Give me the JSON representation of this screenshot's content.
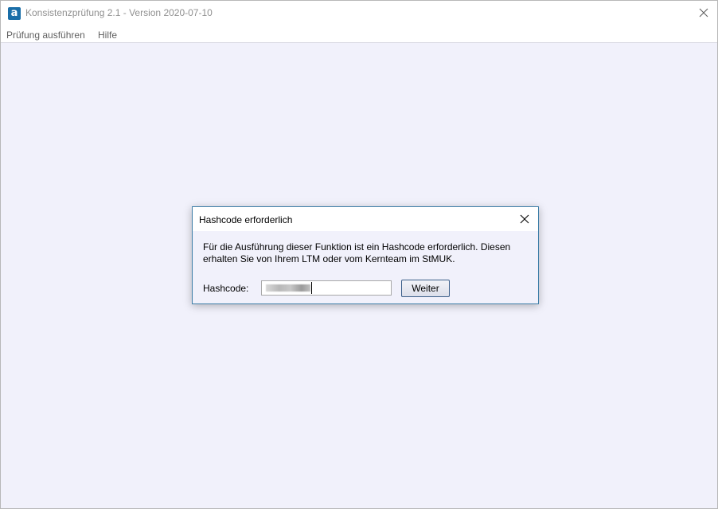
{
  "window": {
    "app_icon_glyph": "a",
    "title": "Konsistenzprüfung 2.1 - Version 2020-07-10",
    "close_icon": "close-icon"
  },
  "menubar": {
    "items": [
      {
        "label": "Prüfung ausführen"
      },
      {
        "label": "Hilfe"
      }
    ]
  },
  "dialog": {
    "title": "Hashcode erforderlich",
    "message_line1": "Für die Ausführung dieser Funktion ist ein Hashcode erforderlich. Diesen",
    "message_line2": "erhalten Sie von Ihrem LTM oder vom Kernteam im StMUK.",
    "hash_label": "Hashcode:",
    "hash_value": "",
    "button_label": "Weiter"
  },
  "colors": {
    "background": "#f1f1fb",
    "dialog_border": "#3f7fa8",
    "app_icon": "#1a6ea8",
    "button_border": "#3c5f8a"
  }
}
